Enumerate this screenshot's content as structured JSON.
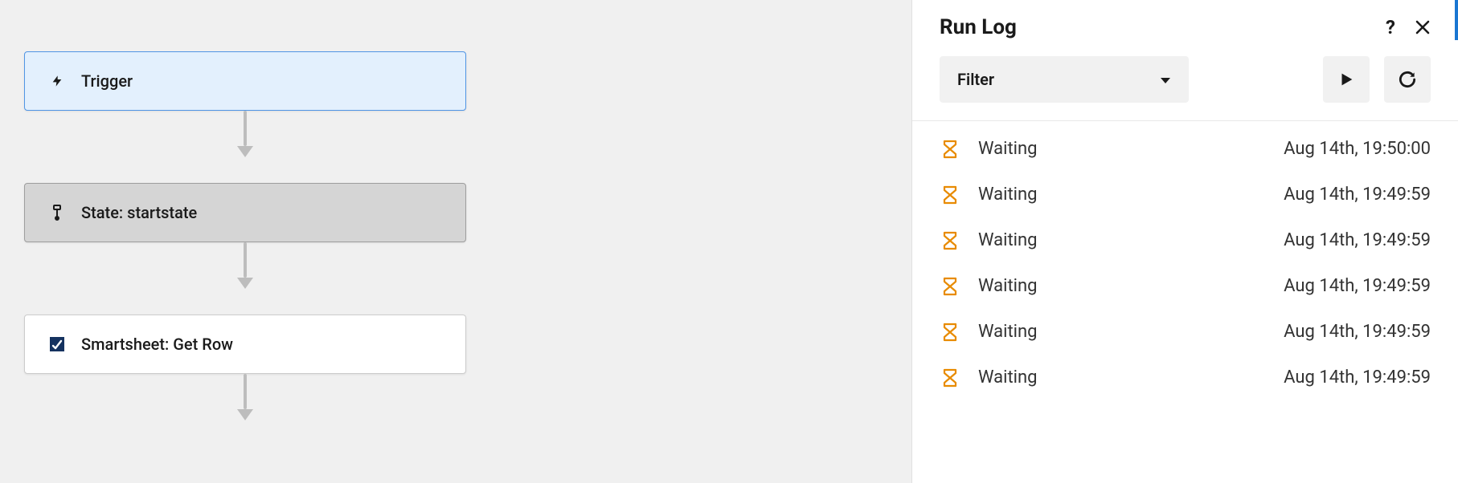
{
  "canvas": {
    "nodes": {
      "trigger": {
        "label": "Trigger"
      },
      "state": {
        "label": "State: startstate"
      },
      "action": {
        "label": "Smartsheet: Get Row"
      }
    }
  },
  "panel": {
    "title": "Run Log",
    "filter_label": "Filter",
    "entries": [
      {
        "status": "Waiting",
        "timestamp": "Aug 14th, 19:50:00"
      },
      {
        "status": "Waiting",
        "timestamp": "Aug 14th, 19:49:59"
      },
      {
        "status": "Waiting",
        "timestamp": "Aug 14th, 19:49:59"
      },
      {
        "status": "Waiting",
        "timestamp": "Aug 14th, 19:49:59"
      },
      {
        "status": "Waiting",
        "timestamp": "Aug 14th, 19:49:59"
      },
      {
        "status": "Waiting",
        "timestamp": "Aug 14th, 19:49:59"
      }
    ]
  }
}
